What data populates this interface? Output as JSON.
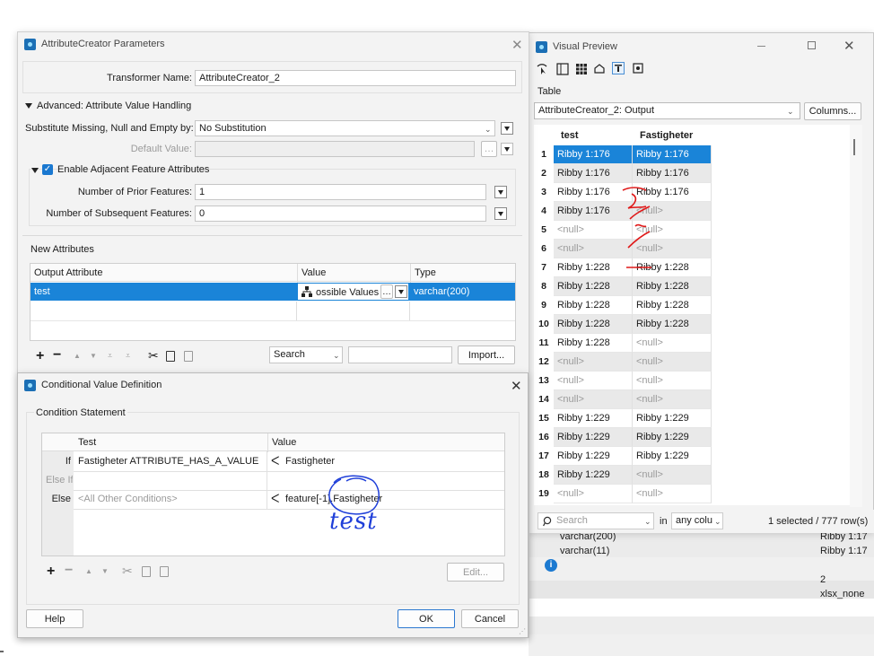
{
  "attr_creator": {
    "title": "AttributeCreator Parameters",
    "transformer_name_label": "Transformer Name:",
    "transformer_name_value": "AttributeCreator_2",
    "advanced_heading": "Advanced: Attribute Value Handling",
    "substitute_label": "Substitute Missing, Null and Empty by:",
    "substitute_value": "No Substitution",
    "default_value_label": "Default Value:",
    "enable_adjacent_label": "Enable Adjacent Feature Attributes",
    "prior_label": "Number of Prior Features:",
    "prior_value": "1",
    "subsequent_label": "Number of Subsequent Features:",
    "subsequent_value": "0",
    "new_attributes_heading": "New Attributes",
    "columns": [
      "Output Attribute",
      "Value",
      "Type"
    ],
    "row": {
      "output": "test",
      "value": "ossible Values",
      "type": "varchar(200)"
    },
    "search_label": "Search",
    "import_label": "Import..."
  },
  "conditional": {
    "title": "Conditional Value Definition",
    "section_label": "Condition Statement",
    "columns": [
      "Test",
      "Value"
    ],
    "rows": [
      {
        "kw": "If",
        "test": "Fastigheter ATTRIBUTE_HAS_A_VALUE",
        "value": "Fastigheter"
      },
      {
        "kw": "Else If",
        "test": "",
        "value": ""
      },
      {
        "kw": "Else",
        "test": "<All Other Conditions>",
        "value": "feature[-1].Fastigheter"
      }
    ],
    "edit_label": "Edit...",
    "help_label": "Help",
    "ok_label": "OK",
    "cancel_label": "Cancel",
    "handwritten": "test"
  },
  "visual_preview": {
    "title": "Visual Preview",
    "table_label": "Table",
    "source": "AttributeCreator_2: Output",
    "columns_button": "Columns...",
    "headers": [
      "test",
      "Fastigheter"
    ],
    "rows": [
      {
        "n": "1",
        "test": "Ribby 1:176",
        "fast": "Ribby 1:176"
      },
      {
        "n": "2",
        "test": "Ribby 1:176",
        "fast": "Ribby 1:176"
      },
      {
        "n": "3",
        "test": "Ribby 1:176",
        "fast": "Ribby 1:176"
      },
      {
        "n": "4",
        "test": "Ribby 1:176",
        "fast": "<null>"
      },
      {
        "n": "5",
        "test": "<null>",
        "fast": "<null>"
      },
      {
        "n": "6",
        "test": "<null>",
        "fast": "<null>"
      },
      {
        "n": "7",
        "test": "Ribby 1:228",
        "fast": "Ribby 1:228"
      },
      {
        "n": "8",
        "test": "Ribby 1:228",
        "fast": "Ribby 1:228"
      },
      {
        "n": "9",
        "test": "Ribby 1:228",
        "fast": "Ribby 1:228"
      },
      {
        "n": "10",
        "test": "Ribby 1:228",
        "fast": "Ribby 1:228"
      },
      {
        "n": "11",
        "test": "Ribby 1:228",
        "fast": "<null>"
      },
      {
        "n": "12",
        "test": "<null>",
        "fast": "<null>"
      },
      {
        "n": "13",
        "test": "<null>",
        "fast": "<null>"
      },
      {
        "n": "14",
        "test": "<null>",
        "fast": "<null>"
      },
      {
        "n": "15",
        "test": "Ribby 1:229",
        "fast": "Ribby 1:229"
      },
      {
        "n": "16",
        "test": "Ribby 1:229",
        "fast": "Ribby 1:229"
      },
      {
        "n": "17",
        "test": "Ribby 1:229",
        "fast": "Ribby 1:229"
      },
      {
        "n": "18",
        "test": "Ribby 1:229",
        "fast": "<null>"
      },
      {
        "n": "19",
        "test": "<null>",
        "fast": "<null>"
      }
    ],
    "search_placeholder": "Search",
    "in_label": "in",
    "scope": "any colu",
    "status": "1 selected / 777 row(s)"
  },
  "background": {
    "type1": "varchar(200)",
    "type2": "varchar(11)",
    "val1": "Ribby 1:17",
    "val2": "Ribby 1:17",
    "num": "2",
    "fmt": "xlsx_none"
  }
}
